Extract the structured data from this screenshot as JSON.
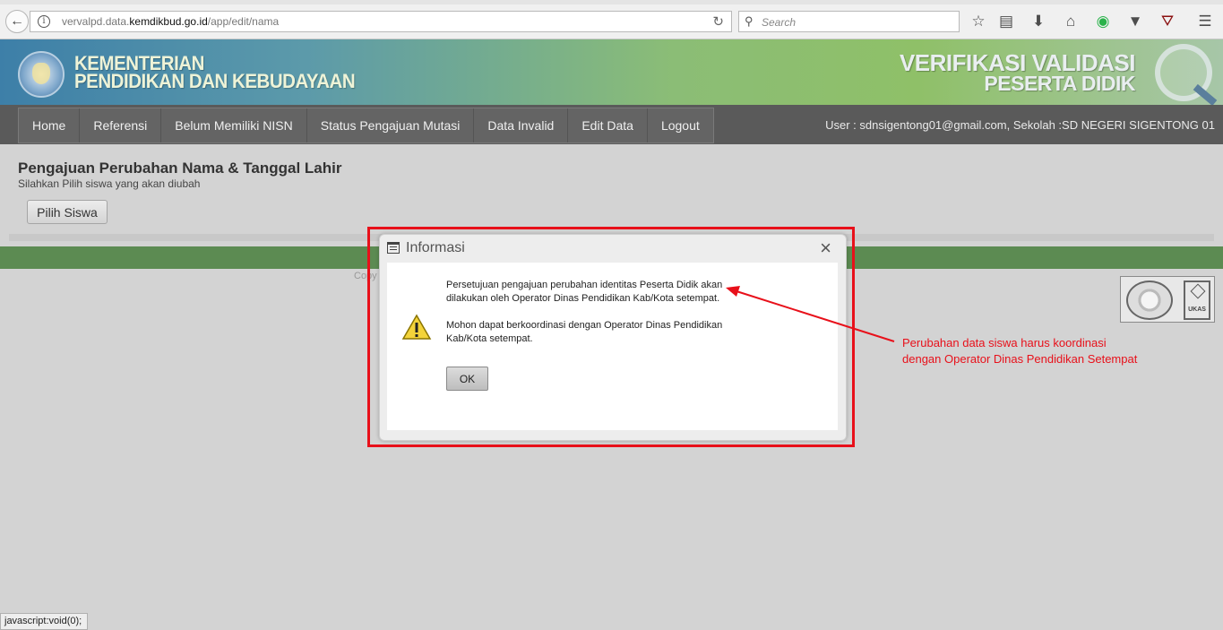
{
  "browser": {
    "url_prefix": "vervalpd.data.",
    "url_domain": "kemdikbud.go.id",
    "url_path": "/app/edit/nama",
    "search_placeholder": "Search"
  },
  "header": {
    "ministry_line1": "KEMENTERIAN",
    "ministry_line2": "PENDIDIKAN DAN KEBUDAYAAN",
    "app_line1": "VERIFIKASI VALIDASI",
    "app_line2": "PESERTA DIDIK"
  },
  "nav": {
    "items": [
      {
        "label": "Home"
      },
      {
        "label": "Referensi"
      },
      {
        "label": "Belum Memiliki NISN"
      },
      {
        "label": "Status Pengajuan Mutasi"
      },
      {
        "label": "Data Invalid"
      },
      {
        "label": "Edit Data"
      },
      {
        "label": "Logout"
      }
    ],
    "user_info": "User : sdnsigentong01@gmail.com, Sekolah :SD NEGERI SIGENTONG 01"
  },
  "page": {
    "title": "Pengajuan Perubahan Nama & Tanggal Lahir",
    "subtitle": "Silahkan Pilih siswa yang akan diubah",
    "pilih_button": "Pilih Siswa",
    "copy_text": "Copy"
  },
  "dialog": {
    "title": "Informasi",
    "close": "×",
    "message_1": "Persetujuan pengajuan perubahan identitas Peserta Didik akan dilakukan oleh Operator Dinas Pendidikan Kab/Kota setempat.",
    "message_2": "Mohon dapat berkoordinasi dengan Operator Dinas Pendidikan Kab/Kota setempat.",
    "ok_button": "OK"
  },
  "annotation": {
    "line1": "Perubahan data siswa harus koordinasi",
    "line2": "dengan Operator Dinas Pendidikan Setempat",
    "color": "#e8101a"
  },
  "certification": {
    "badge": "UKAS"
  },
  "statusbar": {
    "text": "javascript:void(0);"
  },
  "colors": {
    "nav_bg": "#5a5a5a",
    "green_band": "#5c8b52",
    "page_bg": "#d3d3d3"
  }
}
